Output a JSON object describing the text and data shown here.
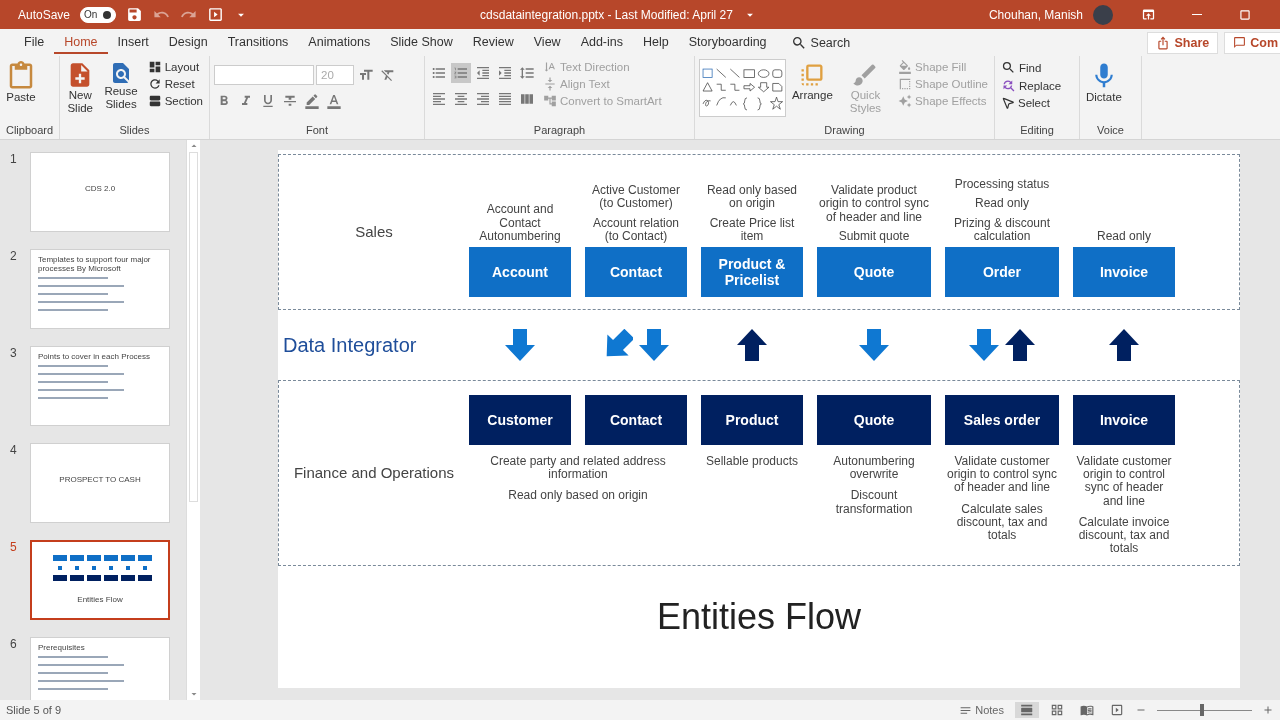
{
  "titlebar": {
    "autosave_label": "AutoSave",
    "autosave_state": "On",
    "autosave_on": true,
    "title": "cdsdataintegration.pptx  -  Last Modified: April 27",
    "user": "Chouhan, Manish"
  },
  "menu_tabs": [
    {
      "label": "File",
      "selected": false
    },
    {
      "label": "Home",
      "selected": true
    },
    {
      "label": "Insert",
      "selected": false
    },
    {
      "label": "Design",
      "selected": false
    },
    {
      "label": "Transitions",
      "selected": false
    },
    {
      "label": "Animations",
      "selected": false
    },
    {
      "label": "Slide Show",
      "selected": false
    },
    {
      "label": "Review",
      "selected": false
    },
    {
      "label": "View",
      "selected": false
    },
    {
      "label": "Add-ins",
      "selected": false
    },
    {
      "label": "Help",
      "selected": false
    },
    {
      "label": "Storyboarding",
      "selected": false
    }
  ],
  "search": "Search",
  "share": "Share",
  "comments": "Com",
  "ribbon": {
    "paste": "Paste",
    "clipboard": "Clipboard",
    "new_slide": "New Slide",
    "reuse": "Reuse Slides",
    "layout": "Layout",
    "reset": "Reset",
    "section": "Section",
    "slides": "Slides",
    "font_size": "20",
    "font": "Font",
    "text_direction": "Text Direction",
    "align_text": "Align Text",
    "convert": "Convert to SmartArt",
    "paragraph": "Paragraph",
    "arrange": "Arrange",
    "quick_styles": "Quick Styles",
    "shape_fill": "Shape Fill",
    "shape_outline": "Shape Outline",
    "shape_effects": "Shape Effects",
    "drawing": "Drawing",
    "find": "Find",
    "replace": "Replace",
    "select": "Select",
    "editing": "Editing",
    "dictate": "Dictate",
    "voice": "Voice"
  },
  "thumbnails": [
    {
      "number": "1",
      "kind": "title",
      "title": "CDS 2.0",
      "selected": false
    },
    {
      "number": "2",
      "kind": "content",
      "title": "Templates to support four major processes By Microsoft",
      "selected": false
    },
    {
      "number": "3",
      "kind": "content",
      "title": "Points to cover in each Process",
      "selected": false
    },
    {
      "number": "4",
      "kind": "title",
      "title": "PROSPECT TO CASH",
      "selected": false
    },
    {
      "number": "5",
      "kind": "diagram",
      "title": "Entities Flow",
      "selected": true
    },
    {
      "number": "6",
      "kind": "content",
      "title": "Prerequisites",
      "selected": false
    }
  ],
  "slide": {
    "sales": {
      "label": "Sales",
      "notes": [
        [
          "Account and Contact Autonumbering"
        ],
        [
          "Active Customer (to Customer)",
          "Account relation (to Contact)"
        ],
        [
          "Read only based on origin",
          "Create Price list item"
        ],
        [
          "Validate product origin to control sync of header and line",
          "Submit quote"
        ],
        [
          "Processing status",
          "Read only",
          "Prizing & discount calculation"
        ],
        [
          "Read only"
        ]
      ],
      "entities": [
        "Account",
        "Contact",
        "Product & Pricelist",
        "Quote",
        "Order",
        "Invoice"
      ]
    },
    "integrator": {
      "label": "Data Integrator",
      "arrows": [
        [
          {
            "kind": "down",
            "color": "#0f78d2"
          }
        ],
        [
          {
            "kind": "diagonal",
            "color": "#0f78d2"
          },
          {
            "kind": "down",
            "color": "#0f78d2"
          }
        ],
        [
          {
            "kind": "up",
            "color": "#002060"
          }
        ],
        [
          {
            "kind": "down",
            "color": "#0f78d2"
          }
        ],
        [
          {
            "kind": "down",
            "color": "#0f78d2"
          },
          {
            "kind": "up",
            "color": "#002060"
          }
        ],
        [
          {
            "kind": "up",
            "color": "#002060"
          }
        ]
      ]
    },
    "finance": {
      "label": "Finance and Operations",
      "entities": [
        "Customer",
        "Contact",
        "Product",
        "Quote",
        "Sales order",
        "Invoice"
      ],
      "notes": [
        {
          "kind": "wide",
          "lines": [
            "Create party and related address information",
            "Read only based on origin"
          ]
        },
        {
          "kind": "single",
          "lines": [
            "Sellable products"
          ]
        },
        {
          "kind": "single",
          "lines": [
            "Autonumbering overwrite",
            "Discount transformation"
          ]
        },
        {
          "kind": "single",
          "lines": [
            "Validate customer origin to control sync of header and line",
            "Calculate sales discount, tax and totals"
          ]
        },
        {
          "kind": "single",
          "lines": [
            "Validate customer origin to control sync of header and line",
            "Calculate invoice discount, tax and totals"
          ]
        }
      ]
    },
    "title": "Entities Flow"
  },
  "status": {
    "slide_info": "Slide 5 of 9",
    "notes": "Notes",
    "zoom": {
      "level": 0.47
    }
  }
}
